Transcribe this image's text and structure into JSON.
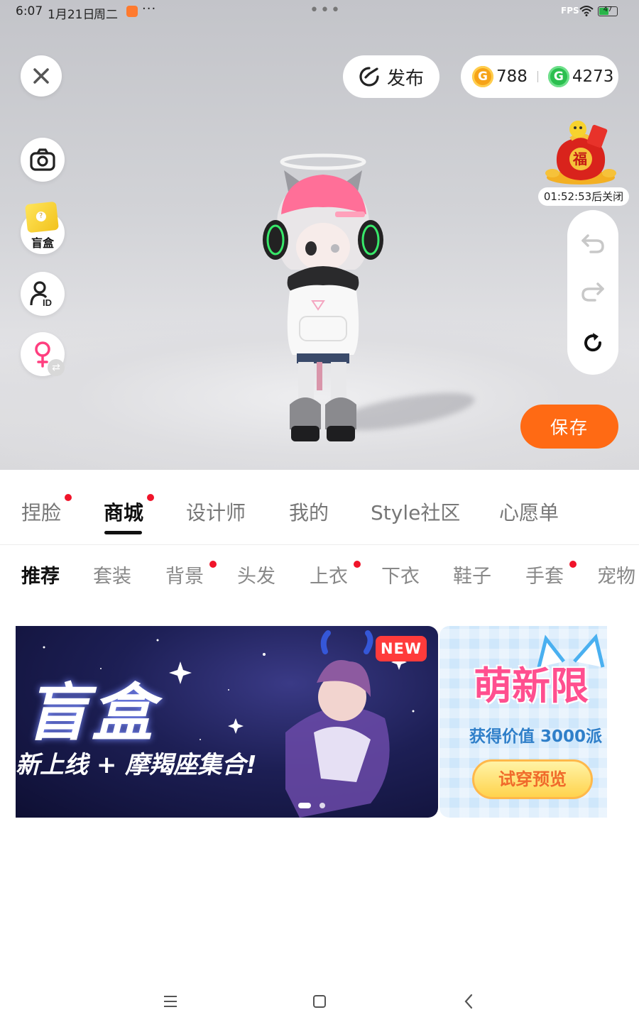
{
  "status_bar": {
    "time": "6:07",
    "date": "1月21日",
    "weekday": "周二",
    "more": "···",
    "center_dots": "•••",
    "fps": "FPS",
    "battery": "47"
  },
  "top_bar": {
    "publish_label": "发布",
    "gold_coins": "788",
    "green_coins": "4273"
  },
  "left_tools": {
    "blindbox_label": "盲盒"
  },
  "event": {
    "timer_text": "01:52:53后关闭"
  },
  "save_label": "保存",
  "main_tabs": [
    {
      "label": "捏脸",
      "red_dot": true
    },
    {
      "label": "商城",
      "red_dot": true,
      "active": true
    },
    {
      "label": "设计师"
    },
    {
      "label": "我的"
    },
    {
      "label": "Style社区"
    },
    {
      "label": "心愿单"
    }
  ],
  "sub_tabs": [
    {
      "label": "推荐",
      "active": true
    },
    {
      "label": "套装"
    },
    {
      "label": "背景",
      "red_dot": true
    },
    {
      "label": "头发"
    },
    {
      "label": "上衣",
      "red_dot": true
    },
    {
      "label": "下衣"
    },
    {
      "label": "鞋子"
    },
    {
      "label": "手套",
      "red_dot": true
    },
    {
      "label": "宠物"
    }
  ],
  "banner_main": {
    "title": "盲盒",
    "subtitle": "新上线 + 摩羯座集合!",
    "badge": "NEW"
  },
  "banner_side": {
    "title": "萌新限",
    "subtitle": "获得价值 3000派",
    "button": "试穿预览"
  },
  "colors": {
    "accent": "#ff6a14",
    "red_dot": "#f0142a",
    "gold": "#f6a318",
    "green": "#2bbf4f"
  }
}
